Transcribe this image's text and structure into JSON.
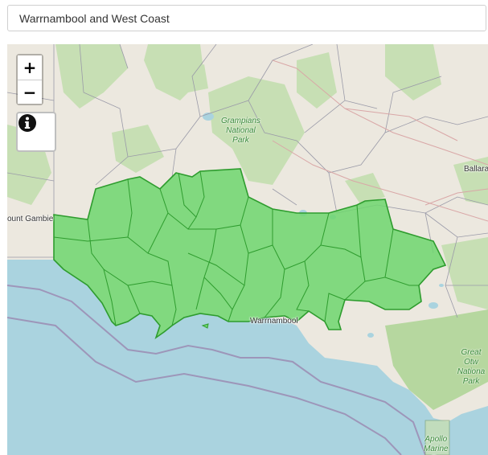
{
  "search": {
    "value": "Warrnambool and West Coast"
  },
  "controls": {
    "zoom_in_label": "+",
    "zoom_out_label": "−",
    "info_icon": "info-circle-icon"
  },
  "map_labels": {
    "grampians": "Grampians\nNational\nPark",
    "mount_gambier": "ount Gambie",
    "ballarat": "Ballara",
    "warrnambool": "Warrnambool",
    "great_otway": "Great Otw\nNationa\nPark",
    "apollo_bay": "Apollo\nMarine\nPa"
  },
  "colors": {
    "land": "#ece8df",
    "sea": "#aad3df",
    "region_fill": "#6fd66f",
    "region_stroke": "#2e9c2e",
    "forest": "#c7dfb4",
    "boundary": "#9a9aa8"
  }
}
